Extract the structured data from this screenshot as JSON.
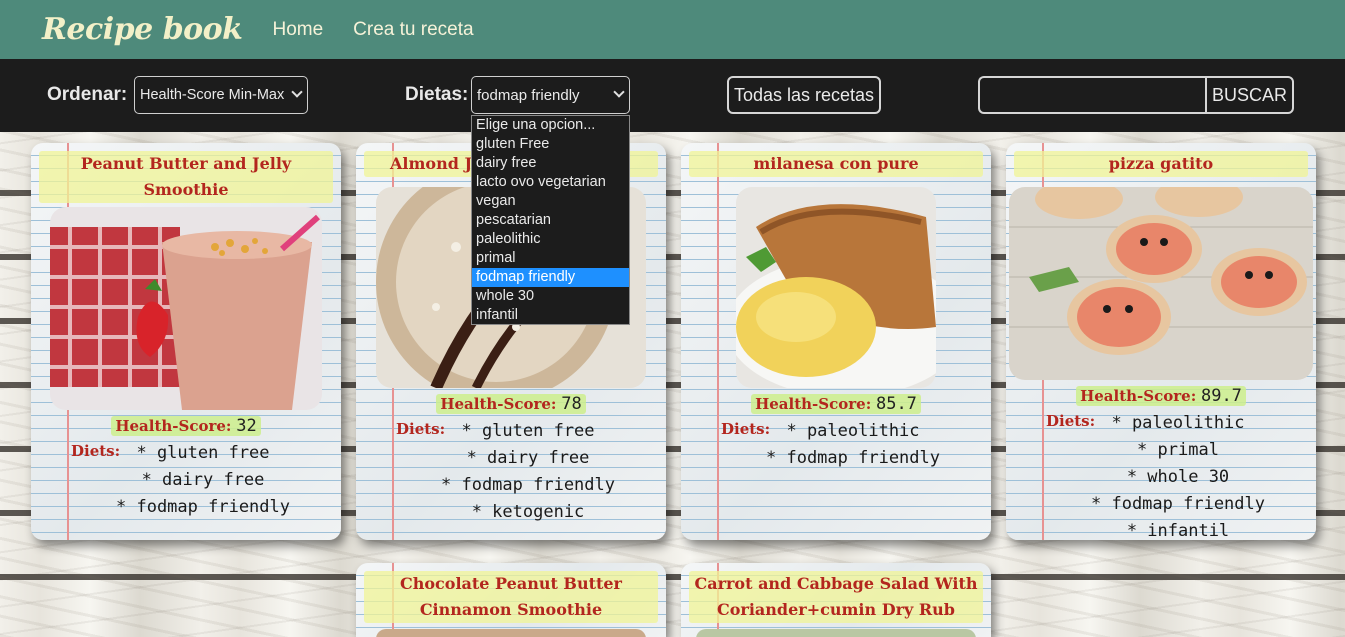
{
  "header": {
    "brand": "Recipe book",
    "nav": [
      "Home",
      "Crea tu receta"
    ]
  },
  "filters": {
    "order_label": "Ordenar:",
    "order_value": "Health-Score Min-Max",
    "diets_label": "Dietas:",
    "diets_value": "fodmap friendly",
    "all_recipes_button": "Todas las recetas",
    "search_value": "",
    "search_button": "BUSCAR",
    "diet_options": [
      "Elige una opcion...",
      "gluten Free",
      "dairy free",
      "lacto ovo vegetarian",
      "vegan",
      "pescatarian",
      "paleolithic",
      "primal",
      "fodmap friendly",
      "whole 30",
      "infantil"
    ],
    "selected_option": "fodmap friendly"
  },
  "colors": {
    "header_bg": "#4e8a7b",
    "filterbar_bg": "#1c1c1c",
    "title_red": "#b3261e",
    "highlight_yellow": "#f0f496",
    "highlight_green": "#cceE8c",
    "select_highlight": "#1e90ff"
  },
  "cards": [
    {
      "title": "Peanut Butter and Jelly Smoothie",
      "health_label": "Health-Score:",
      "health_score": "32",
      "diets_label": "Diets:",
      "diets": [
        "* gluten free",
        "* dairy free",
        "* fodmap friendly"
      ],
      "image": "smoothie-photo"
    },
    {
      "title": "Almond Joy",
      "health_label": "Health-Score:",
      "health_score": "78",
      "diets_label": "Diets:",
      "diets": [
        "* gluten free",
        "* dairy free",
        "* fodmap friendly",
        "* ketogenic"
      ],
      "image": "almond-dessert-photo"
    },
    {
      "title": "milanesa con pure",
      "health_label": "Health-Score:",
      "health_score": "85.7",
      "diets_label": "Diets:",
      "diets": [
        "* paleolithic",
        "* fodmap friendly"
      ],
      "image": "milanesa-photo"
    },
    {
      "title": "pizza gatito",
      "health_label": "Health-Score:",
      "health_score": "89.7",
      "diets_label": "Diets:",
      "diets": [
        "* paleolithic",
        "* primal",
        "* whole 30",
        "* fodmap friendly",
        "* infantil"
      ],
      "image": "cat-pizza-photo"
    },
    {
      "title": "Chocolate Peanut Butter Cinnamon Smoothie",
      "image": "chocolate-smoothie-photo"
    },
    {
      "title": "Carrot and Cabbage Salad With Coriander+cumin Dry Rub",
      "image": "salad-photo"
    }
  ]
}
